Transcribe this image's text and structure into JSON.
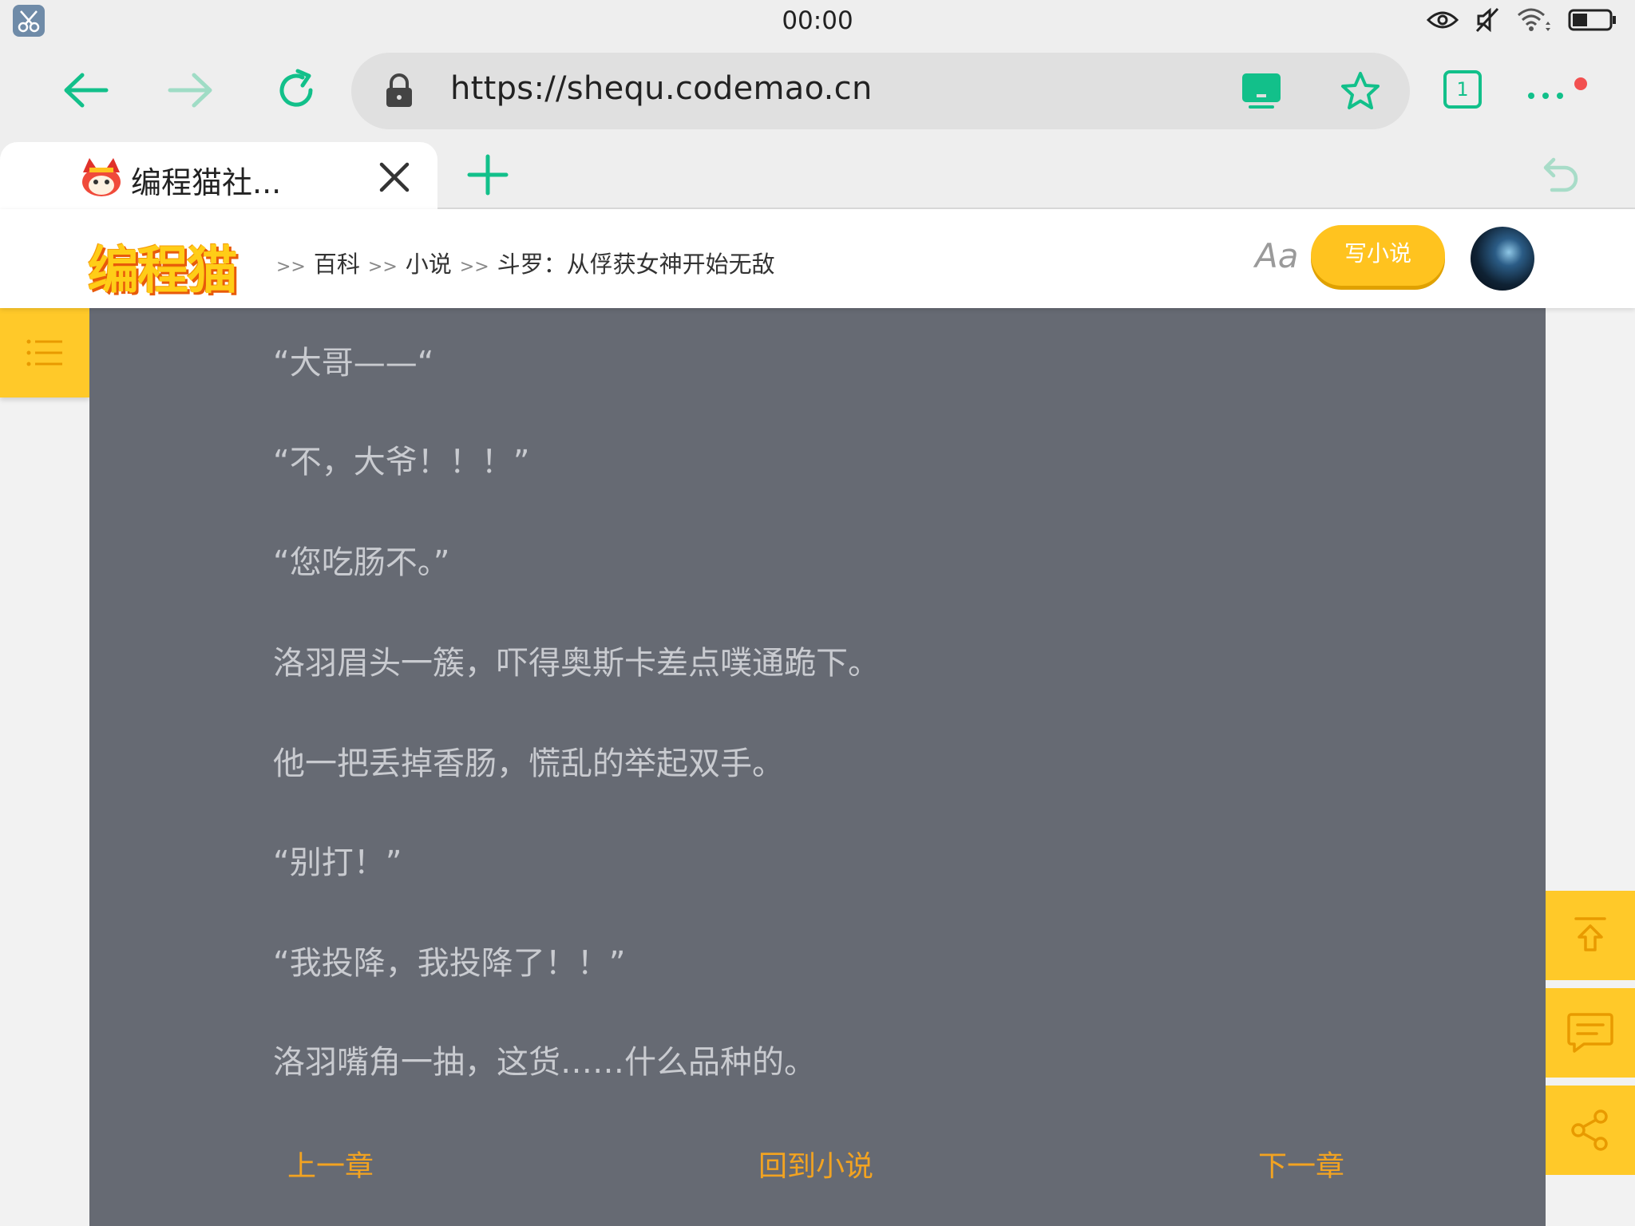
{
  "status_bar": {
    "time": "00:00"
  },
  "browser": {
    "url": "https://shequ.codemao.cn",
    "tab_count": "1",
    "active_tab": {
      "title": "编程猫社..."
    }
  },
  "site": {
    "logo": "编程猫",
    "breadcrumbs": [
      ">>",
      "百科",
      ">>",
      "小说",
      ">>",
      "斗罗：从俘获女神开始无敌"
    ],
    "font_toggle": "Aa",
    "write_button": "写小说"
  },
  "content": {
    "paragraphs": [
      "“大哥——“",
      "“不，大爷！！！”",
      "“您吃肠不。”",
      "洛羽眉头一簇，吓得奥斯卡差点噗通跪下。",
      "他一把丢掉香肠，慌乱的举起双手。",
      "“别打！”",
      "“我投降，我投降了！！”",
      "洛羽嘴角一抽，这货……什么品种的。"
    ],
    "nav": {
      "prev": "上一章",
      "back": "回到小说",
      "next": "下一章"
    }
  },
  "colors": {
    "accent_green": "#12c08a",
    "accent_yellow": "#ffc929",
    "reader_bg": "#666a73",
    "link_orange": "#f2a321"
  },
  "icons": {
    "status": [
      "scissors-app-icon",
      "eye-icon",
      "mute-icon",
      "wifi-icon",
      "battery-icon"
    ],
    "toolbar": [
      "back-arrow-icon",
      "forward-arrow-icon",
      "refresh-icon",
      "lock-icon",
      "screen-cast-icon",
      "star-icon",
      "more-dots-icon"
    ],
    "side": [
      "list-icon",
      "back-to-top-icon",
      "comment-icon",
      "share-icon"
    ]
  }
}
